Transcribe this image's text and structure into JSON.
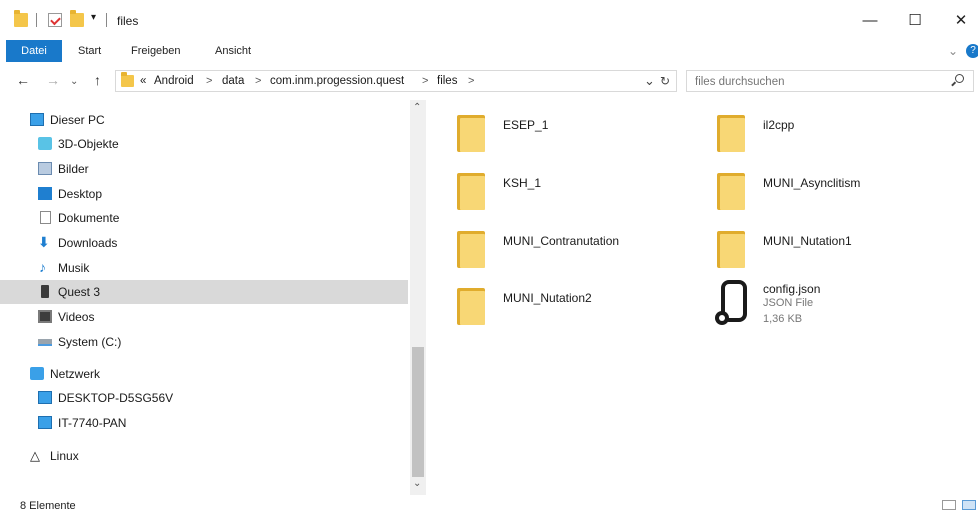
{
  "window": {
    "title": "files"
  },
  "window_controls": {
    "minimize": "—",
    "maximize": "☐",
    "close": "✕"
  },
  "ribbon": {
    "tabs": [
      "Datei",
      "Start",
      "Freigeben",
      "Ansicht"
    ],
    "expand": "⌄",
    "help": "?"
  },
  "nav": {
    "back": "←",
    "forward": "→",
    "up": "↑"
  },
  "address": {
    "prefix": "«",
    "crumbs": [
      "Android",
      "data",
      "com.inm.progession.quest",
      "files"
    ],
    "separator": ">",
    "dropdown": "⌄",
    "refresh": "↻"
  },
  "search": {
    "placeholder": "files durchsuchen"
  },
  "sidebar": {
    "items": [
      {
        "label": "Dieser PC",
        "icon": "computer-icon"
      },
      {
        "label": "3D-Objekte",
        "icon": "3d-objects-icon"
      },
      {
        "label": "Bilder",
        "icon": "pictures-icon"
      },
      {
        "label": "Desktop",
        "icon": "desktop-icon"
      },
      {
        "label": "Dokumente",
        "icon": "documents-icon"
      },
      {
        "label": "Downloads",
        "icon": "downloads-icon"
      },
      {
        "label": "Musik",
        "icon": "music-icon"
      },
      {
        "label": "Quest 3",
        "icon": "device-icon",
        "selected": true
      },
      {
        "label": "Videos",
        "icon": "videos-icon"
      },
      {
        "label": "System (C:)",
        "icon": "drive-icon"
      },
      {
        "label": "Netzwerk",
        "icon": "network-icon"
      },
      {
        "label": "DESKTOP-D5SG56V",
        "icon": "network-computer-icon"
      },
      {
        "label": "IT-7740-PAN",
        "icon": "network-computer-icon"
      },
      {
        "label": "Linux",
        "icon": "linux-icon"
      }
    ]
  },
  "files": [
    {
      "name": "ESEP_1",
      "type": "folder"
    },
    {
      "name": "il2cpp",
      "type": "folder"
    },
    {
      "name": "KSH_1",
      "type": "folder"
    },
    {
      "name": "MUNI_Asynclitism",
      "type": "folder"
    },
    {
      "name": "MUNI_Contranutation",
      "type": "folder"
    },
    {
      "name": "MUNI_Nutation1",
      "type": "folder"
    },
    {
      "name": "MUNI_Nutation2",
      "type": "folder"
    },
    {
      "name": "config.json",
      "type": "file",
      "kind": "JSON File",
      "size": "1,36 KB"
    }
  ],
  "status": {
    "count": "8 Elemente"
  },
  "colors": {
    "accent": "#1979ca",
    "folder": "#f8d775",
    "selected": "#d9d9d9"
  }
}
